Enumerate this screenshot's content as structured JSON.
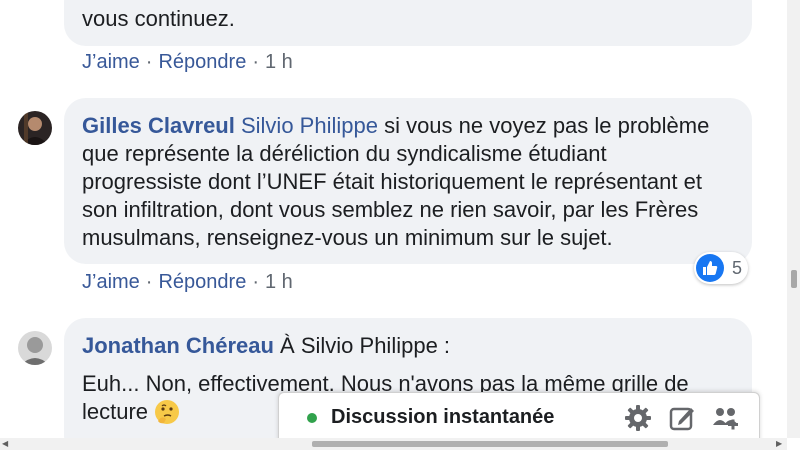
{
  "comment1": {
    "text_tail": "vous continuez.",
    "actions": {
      "like": "J’aime",
      "reply": "Répondre",
      "time": "1 h",
      "sep": "·"
    }
  },
  "comment2": {
    "author": "Gilles Clavreul",
    "mention": "Silvio Philippe",
    "line1": " si vous ne voyez pas le problème",
    "line2": "que représente la déréliction du syndicalisme étudiant",
    "line3": "progressiste dont l’UNEF était historiquement le représentant et",
    "line4": "son infiltration, dont vous semblez ne rien savoir, par les Frères",
    "line5": "musulmans, renseignez-vous un minimum sur le sujet.",
    "actions": {
      "like": "J’aime",
      "reply": "Répondre",
      "time": "1 h",
      "sep": "·"
    },
    "reactions": {
      "icon": "thumbs-up-icon",
      "count": "5"
    }
  },
  "comment3": {
    "author": "Jonathan Chéreau",
    "line1": " À Silvio Philippe :",
    "line2": "Euh... Non, effectivement. Nous n'avons pas la même grille de",
    "line3": "lecture"
  },
  "chat": {
    "title": "Discussion instantanée",
    "status_color": "#31a24c",
    "icons": [
      "gear-icon",
      "new-message-icon",
      "add-group-icon"
    ]
  },
  "colors": {
    "link": "#365899",
    "bubble": "#f0f2f5",
    "like_blue": "#1877f2"
  }
}
